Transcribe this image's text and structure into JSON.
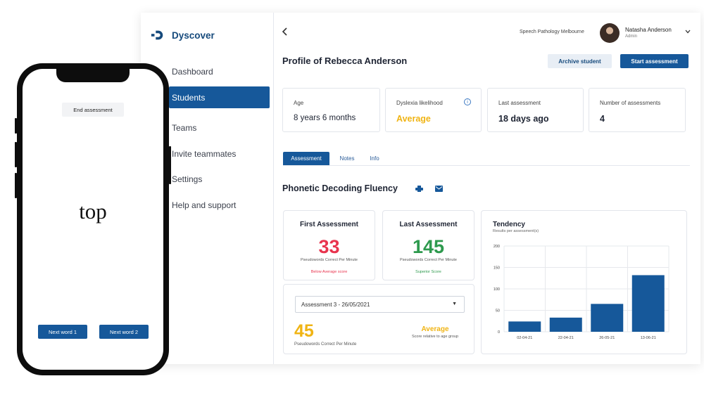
{
  "app": {
    "brand": "Dyscover",
    "nav": [
      {
        "label": "Dashboard",
        "active": false
      },
      {
        "label": "Students",
        "active": true
      },
      {
        "label": "Teams",
        "active": false
      },
      {
        "label": "Invite teammates",
        "active": false
      },
      {
        "label": "Settings",
        "active": false
      },
      {
        "label": "Help and support",
        "active": false
      }
    ],
    "back_icon": "chevron-left-icon",
    "organization": "Speech Pathology Melbourne",
    "user": {
      "name": "Natasha Anderson",
      "role": "Admin"
    },
    "page_title": "Profile of Rebecca Anderson",
    "buttons": {
      "archive": "Archive student",
      "start": "Start assessment"
    },
    "stats": [
      {
        "label": "Age",
        "value": "8 years 6 months"
      },
      {
        "label": "Dyslexia likelihood",
        "value": "Average"
      },
      {
        "label": "Last assessment",
        "value": "18 days ago"
      },
      {
        "label": "Number of assessments",
        "value": "4"
      }
    ],
    "tabs": [
      "Assessment",
      "Notes",
      "Info"
    ],
    "active_tab": "Assessment",
    "section_title": "Phonetic Decoding Fluency",
    "first": {
      "title": "First Assessment",
      "value": "33",
      "unit": "Pseudowords Correct Per Minute",
      "note": "Below Average score",
      "color": "#e8344e"
    },
    "last": {
      "title": "Last Assessment",
      "value": "145",
      "unit": "Pseudowords Correct Per Minute",
      "note": "Superior Score",
      "color": "#2e9a4e"
    },
    "selected": {
      "option": "Assessment 3 - 26/05/2021",
      "value": "45",
      "unit": "Pseudowords Correct Per Minute",
      "level": "Average",
      "level_note": "Score relative to age group"
    },
    "colors": {
      "primary": "#16589a",
      "average": "#f0b414",
      "below": "#e8344e",
      "superior": "#2e9a4e"
    }
  },
  "chart_data": {
    "type": "bar",
    "title": "Tendency",
    "subtitle": "Results per assessment(s)",
    "categories": [
      "02-04-21",
      "22-04-21",
      "26-05-21",
      "13-06-21"
    ],
    "values": [
      24,
      33,
      65,
      132
    ],
    "yticks": [
      0,
      50,
      100,
      150,
      200
    ],
    "ylim": [
      0,
      200
    ],
    "grid": true,
    "color": "#16589a"
  },
  "phone": {
    "end_label": "End assessment",
    "word": "top",
    "next1": "Next word 1",
    "next2": "Next word 2"
  }
}
